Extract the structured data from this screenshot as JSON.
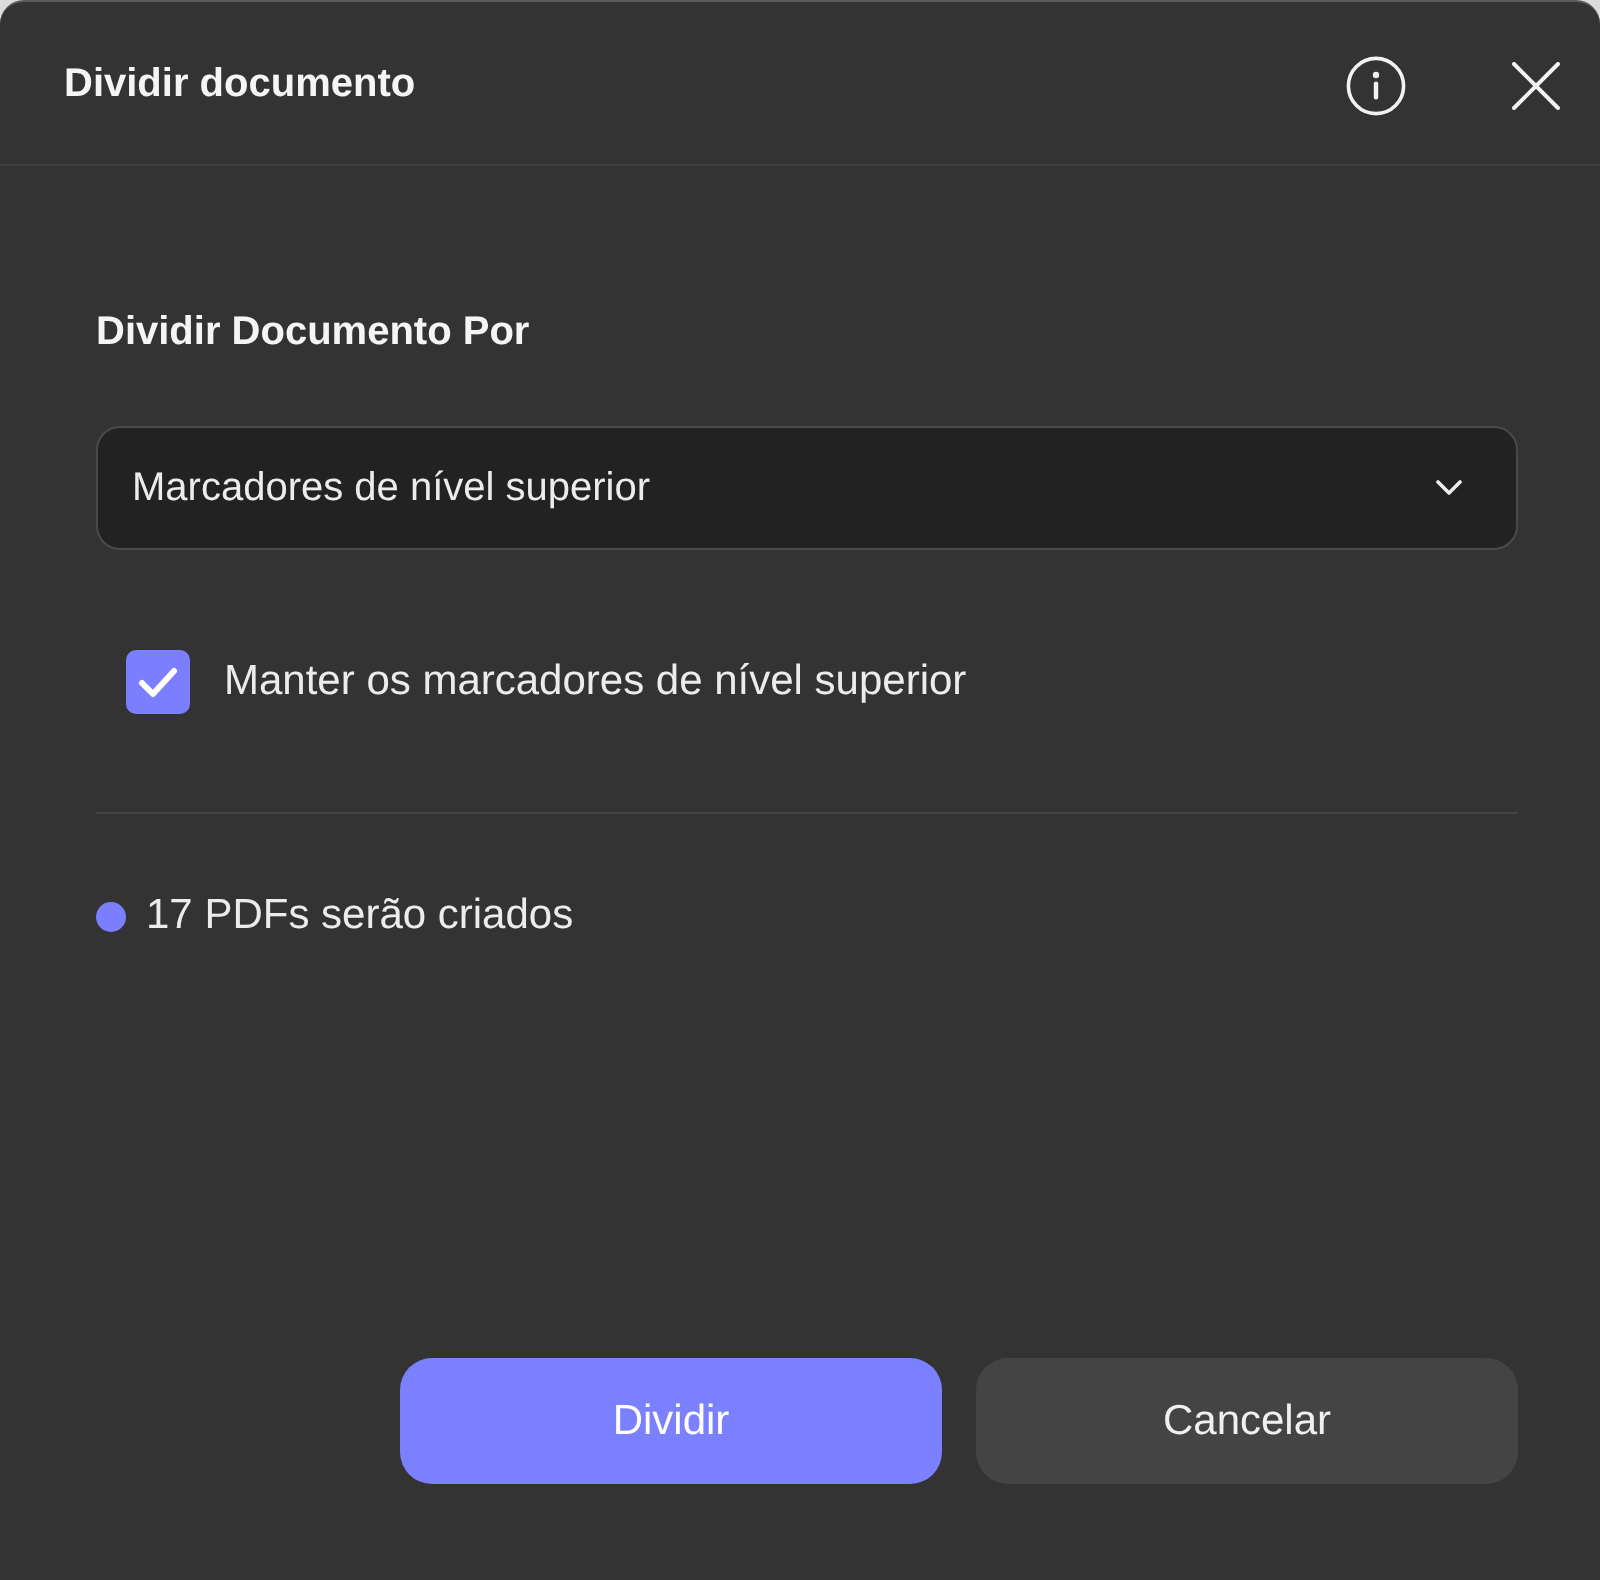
{
  "window": {
    "title": "Dividir documento"
  },
  "split_by": {
    "label": "Dividir Documento Por",
    "dropdown": {
      "value": "Marcadores de nível superior"
    }
  },
  "options": [
    {
      "label": "Manter os marcadores de nível superior",
      "checked": true
    }
  ],
  "summary": {
    "text": "17 PDFs serão criados"
  },
  "buttons": [
    {
      "label": "Dividir",
      "kind": "primary"
    },
    {
      "label": "Cancelar",
      "kind": "secondary"
    }
  ]
}
